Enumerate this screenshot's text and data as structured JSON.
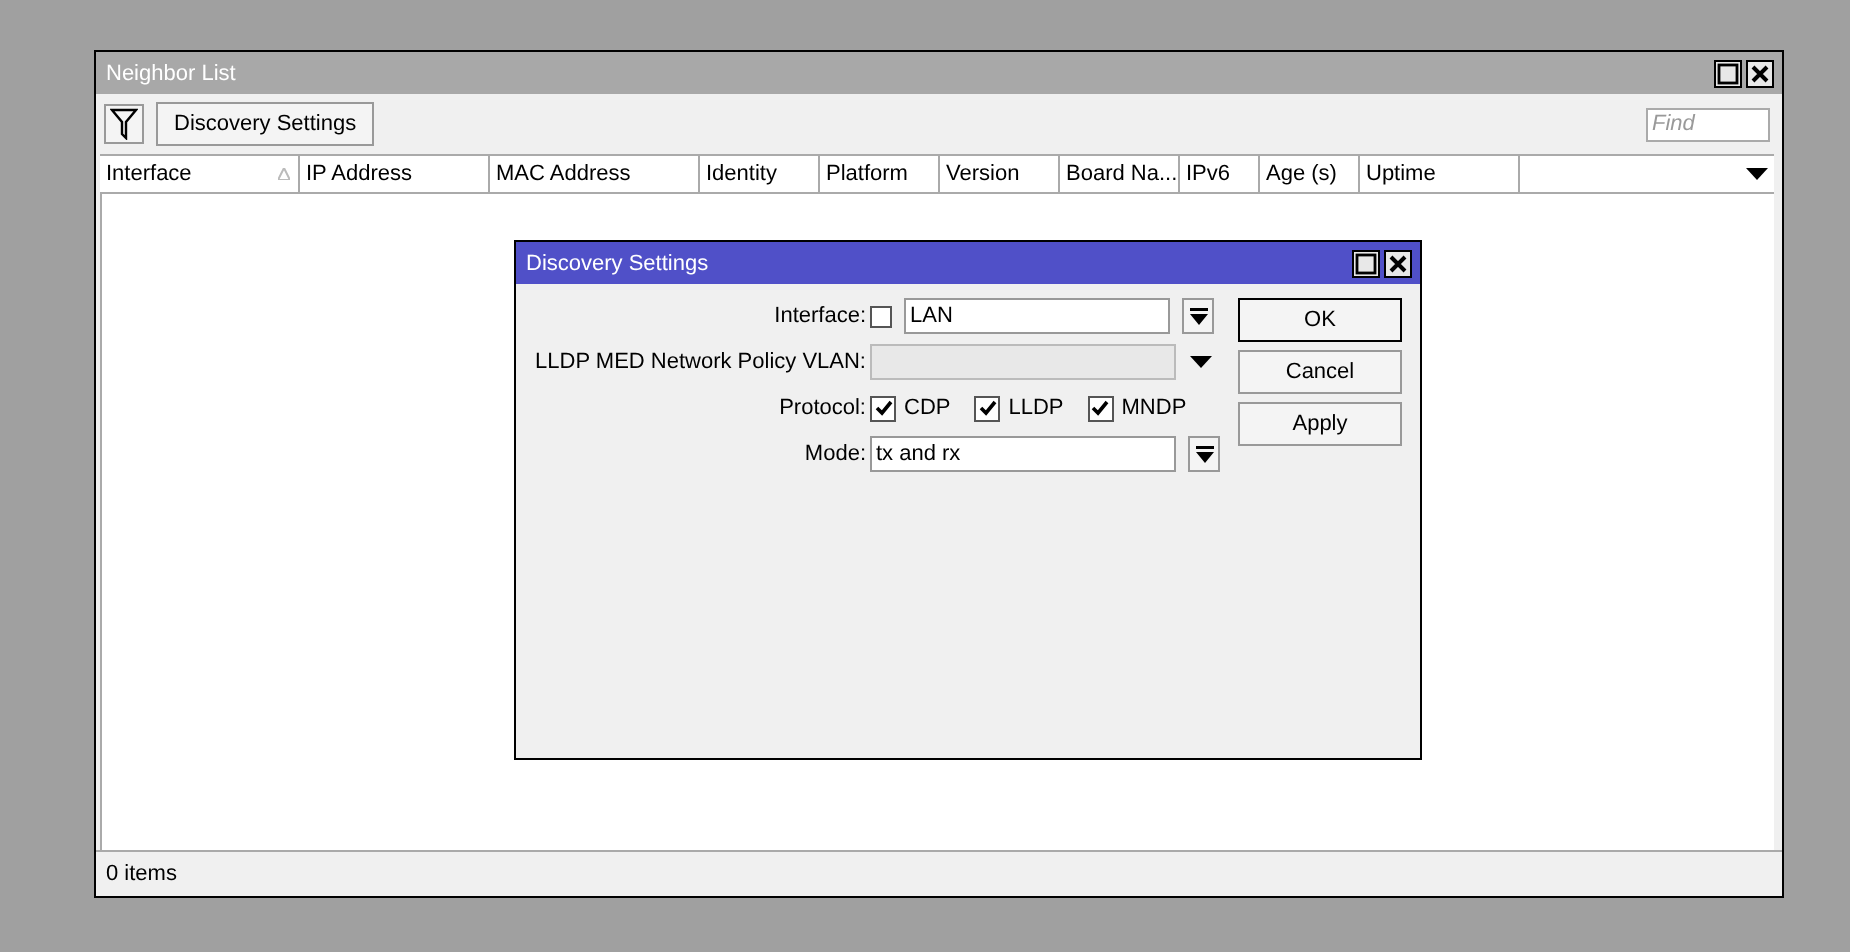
{
  "window": {
    "title": "Neighbor List"
  },
  "toolbar": {
    "button": "Discovery Settings",
    "find": {
      "placeholder": "Find"
    }
  },
  "table": {
    "columns": [
      {
        "label": "Interface",
        "sorted": true
      },
      {
        "label": "IP Address",
        "sorted": false
      },
      {
        "label": "MAC Address",
        "sorted": false
      },
      {
        "label": "Identity",
        "sorted": false
      },
      {
        "label": "Platform",
        "sorted": false
      },
      {
        "label": "Version",
        "sorted": false
      },
      {
        "label": "Board Na...",
        "sorted": false
      },
      {
        "label": "IPv6",
        "sorted": false
      },
      {
        "label": "Age (s)",
        "sorted": false
      },
      {
        "label": "Uptime",
        "sorted": false
      }
    ]
  },
  "status_bar": "0 items",
  "dialog": {
    "title": "Discovery Settings",
    "fields": [
      {
        "kind": "combo",
        "label": "Interface:",
        "negate": false,
        "value": "LAN"
      },
      {
        "kind": "dropdown",
        "label": "LLDP MED Network Policy VLAN:",
        "disabled": true
      },
      {
        "kind": "checkboxes",
        "label": "Protocol:",
        "options": [
          {
            "label": "CDP",
            "checked": true
          },
          {
            "label": "LLDP",
            "checked": true
          },
          {
            "label": "MNDP",
            "checked": true
          }
        ]
      },
      {
        "kind": "combo",
        "label": "Mode:",
        "value": "tx and rx"
      }
    ],
    "buttons": [
      "OK",
      "Cancel",
      "Apply"
    ]
  }
}
